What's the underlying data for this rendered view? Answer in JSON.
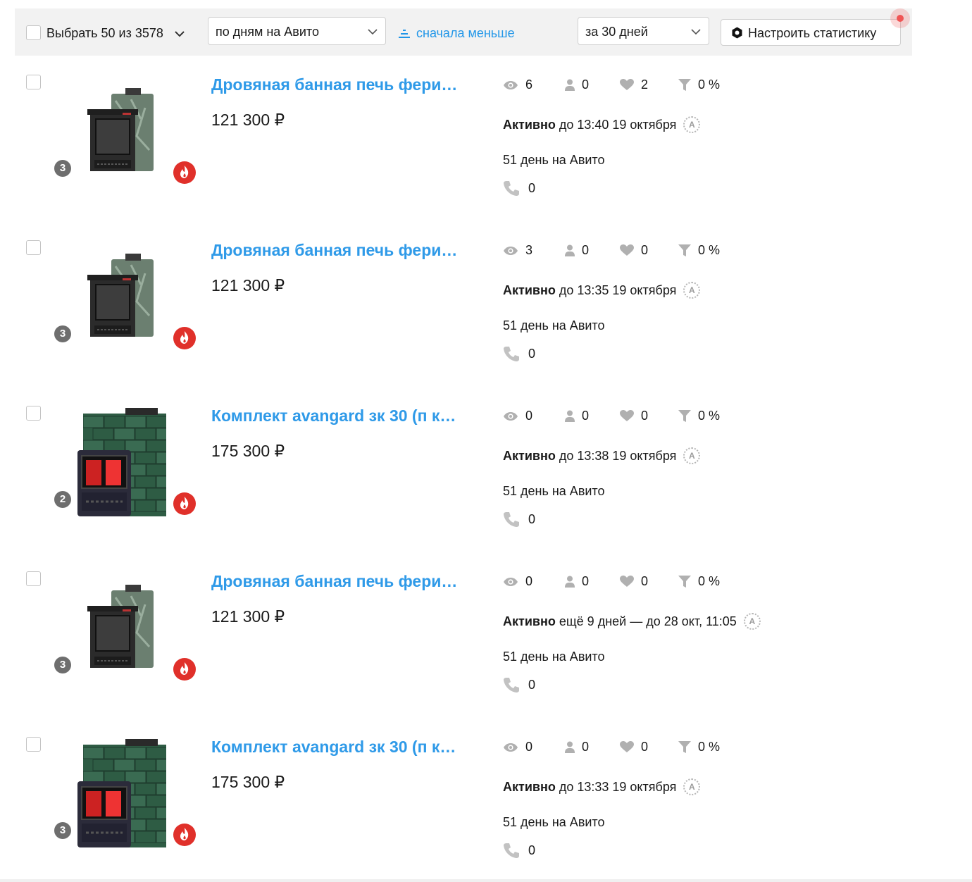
{
  "toolbar": {
    "select_label": "Выбрать 50 из 3578",
    "sort_value": "по дням на Авито",
    "order_label": "сначала меньше",
    "period_value": "за 30 дней",
    "settings_label": "Настроить статистику"
  },
  "colors": {
    "accent_link": "#2f9ae8",
    "toolbar_bg": "#f2f2f2",
    "promo_badge": "#e0302a",
    "notification_dot": "#f05555"
  },
  "listings": [
    {
      "title": "Дровяная банная печь фери…",
      "price": "121 300 ₽",
      "photo_count": "3",
      "image": "stove-small",
      "views": "6",
      "contacts": "0",
      "favorites": "2",
      "conversion": "0 %",
      "status_bold": "Активно",
      "status_rest": "до 13:40 19 октября",
      "days_on_site": "51 день на Авито",
      "calls": "0"
    },
    {
      "title": "Дровяная банная печь фери…",
      "price": "121 300 ₽",
      "photo_count": "3",
      "image": "stove-small",
      "views": "3",
      "contacts": "0",
      "favorites": "0",
      "conversion": "0 %",
      "status_bold": "Активно",
      "status_rest": "до 13:35 19 октября",
      "days_on_site": "51 день на Авито",
      "calls": "0"
    },
    {
      "title": "Комплект avangard зк 30 (п к…",
      "price": "175 300 ₽",
      "photo_count": "2",
      "image": "stove-large",
      "views": "0",
      "contacts": "0",
      "favorites": "0",
      "conversion": "0 %",
      "status_bold": "Активно",
      "status_rest": "до 13:38 19 октября",
      "days_on_site": "51 день на Авито",
      "calls": "0"
    },
    {
      "title": "Дровяная банная печь фери…",
      "price": "121 300 ₽",
      "photo_count": "3",
      "image": "stove-small",
      "views": "0",
      "contacts": "0",
      "favorites": "0",
      "conversion": "0 %",
      "status_bold": "Активно",
      "status_rest": "ещё 9 дней — до 28 окт, 11:05",
      "days_on_site": "51 день на Авито",
      "calls": "0"
    },
    {
      "title": "Комплект avangard зк 30 (п к…",
      "price": "175 300 ₽",
      "photo_count": "3",
      "image": "stove-large",
      "views": "0",
      "contacts": "0",
      "favorites": "0",
      "conversion": "0 %",
      "status_bold": "Активно",
      "status_rest": "до 13:33 19 октября",
      "days_on_site": "51 день на Авито",
      "calls": "0"
    }
  ]
}
